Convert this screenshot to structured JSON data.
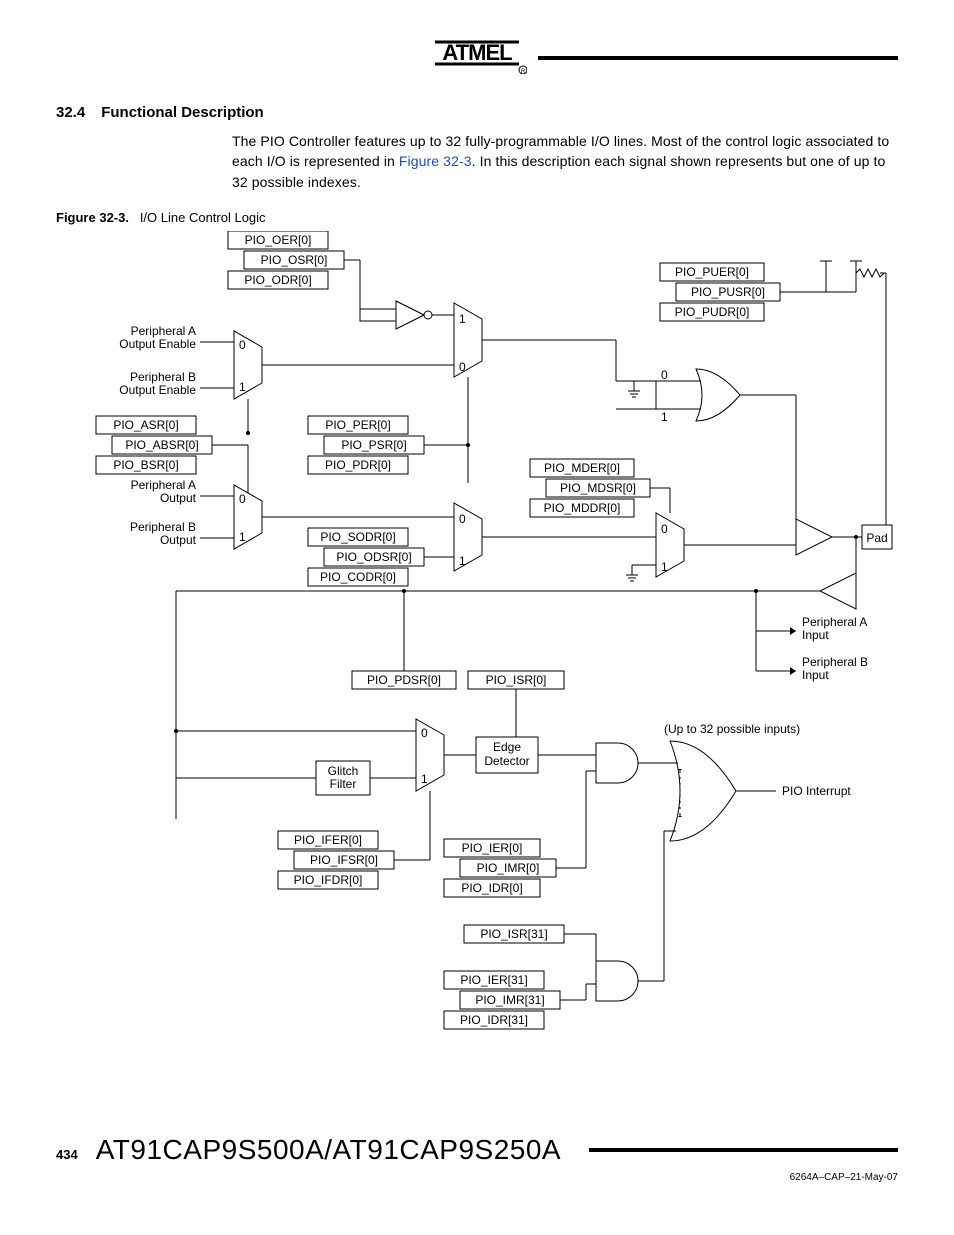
{
  "logo_text": "ATMEL",
  "section_number": "32.4",
  "section_title": "Functional Description",
  "paragraph_pre": "The PIO Controller features up to 32 fully-programmable I/O lines. Most of the control logic associated to each I/O is represented in ",
  "paragraph_link": "Figure 32-3",
  "paragraph_post": ". In this description each signal shown represents but one of up to 32 possible indexes.",
  "figure_label_bold": "Figure 32-3.",
  "figure_label_rest": "I/O Line Control Logic",
  "page_number": "434",
  "part_numbers": "AT91CAP9S500A/AT91CAP9S250A",
  "doc_id": "6264A–CAP–21-May-07",
  "signals": {
    "oer": "PIO_OER[0]",
    "osr": "PIO_OSR[0]",
    "odr": "PIO_ODR[0]",
    "peripheral_a_oe": "Peripheral A\nOutput Enable",
    "peripheral_b_oe": "Peripheral B\nOutput Enable",
    "asr": "PIO_ASR[0]",
    "absr": "PIO_ABSR[0]",
    "bsr": "PIO_BSR[0]",
    "peripheral_a_out": "Peripheral A\nOutput",
    "peripheral_b_out": "Peripheral B\nOutput",
    "per": "PIO_PER[0]",
    "psr": "PIO_PSR[0]",
    "pdr": "PIO_PDR[0]",
    "sodr": "PIO_SODR[0]",
    "odsr": "PIO_ODSR[0]",
    "codr": "PIO_CODR[0]",
    "puer": "PIO_PUER[0]",
    "pusr": "PIO_PUSR[0]",
    "pudr": "PIO_PUDR[0]",
    "mder": "PIO_MDER[0]",
    "mdsr": "PIO_MDSR[0]",
    "mddr": "PIO_MDDR[0]",
    "pad": "Pad",
    "peripheral_a_in": "Peripheral A\nInput",
    "peripheral_b_in": "Peripheral B\nInput",
    "pdsr": "PIO_PDSR[0]",
    "isr0": "PIO_ISR[0]",
    "glitch": "Glitch\nFilter",
    "edge": "Edge\nDetector",
    "ifer": "PIO_IFER[0]",
    "ifsr": "PIO_IFSR[0]",
    "ifdr": "PIO_IFDR[0]",
    "ier0": "PIO_IER[0]",
    "imr0": "PIO_IMR[0]",
    "idr0": "PIO_IDR[0]",
    "isr31": "PIO_ISR[31]",
    "ier31": "PIO_IER[31]",
    "imr31": "PIO_IMR[31]",
    "idr31": "PIO_IDR[31]",
    "inputs_note": "(Up to 32 possible inputs)",
    "pio_int": "PIO Interrupt"
  },
  "mux_labels": {
    "zero": "0",
    "one": "1"
  }
}
